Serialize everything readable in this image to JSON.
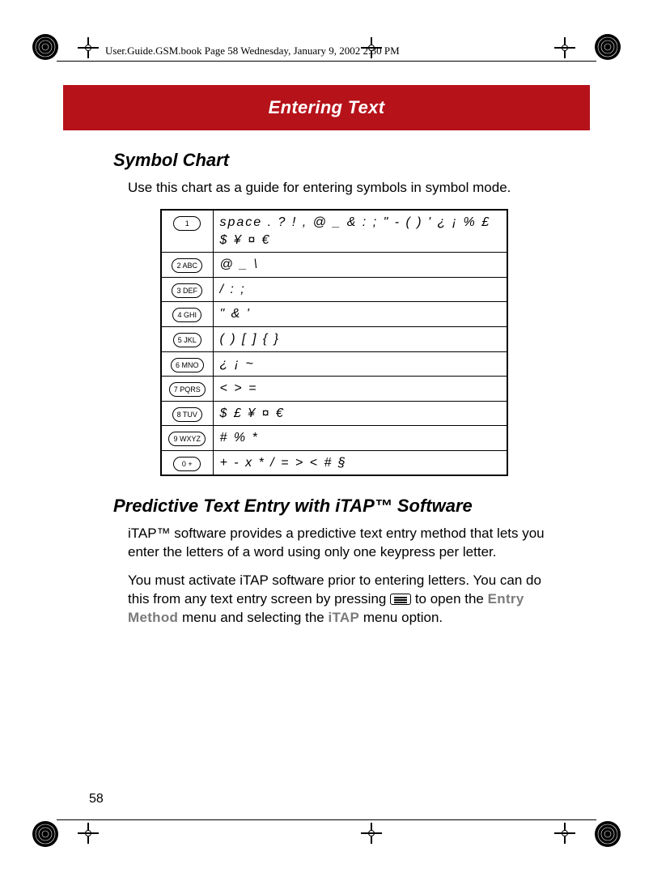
{
  "meta_line": "User.Guide.GSM.book  Page 58  Wednesday, January 9, 2002  2:30 PM",
  "banner_title": "Entering Text",
  "heading_symbol_chart": "Symbol Chart",
  "intro_symbol_chart": "Use this chart as a guide for entering symbols in symbol mode.",
  "chart_data": {
    "type": "table",
    "columns": [
      "key",
      "symbols"
    ],
    "rows": [
      {
        "key": "1",
        "symbols": "space . ? ! , @ _ & : ; \" - ( ) ' ¿ ¡ % £ $ ¥ ¤ €"
      },
      {
        "key": "2 ABC",
        "symbols": "@ _ \\"
      },
      {
        "key": "3 DEF",
        "symbols": "/ : ;"
      },
      {
        "key": "4 GHI",
        "symbols": "\" & '"
      },
      {
        "key": "5 JKL",
        "symbols": "( ) [ ] { }"
      },
      {
        "key": "6 MNO",
        "symbols": "¿ ¡ ~"
      },
      {
        "key": "7 PQRS",
        "symbols": "< > ="
      },
      {
        "key": "8 TUV",
        "symbols": "$ £ ¥ ¤ €"
      },
      {
        "key": "9 WXYZ",
        "symbols": "# % *"
      },
      {
        "key": "0 +",
        "symbols": "+ - x * / = > < # §"
      }
    ]
  },
  "heading_itap": "Predictive Text Entry with iTAP™ Software",
  "itap_p1": "iTAP™ software provides a predictive text entry method that lets you enter the letters of a word using only one keypress per letter.",
  "itap_p2_a": "You must activate iTAP software prior to entering letters. You can do this from any text entry screen by pressing ",
  "itap_p2_b": " to open the ",
  "itap_p2_c": " menu and selecting the ",
  "itap_p2_d": " menu option.",
  "ui_entry_method": "Entry Method",
  "ui_itap": "iTAP",
  "page_number": "58"
}
